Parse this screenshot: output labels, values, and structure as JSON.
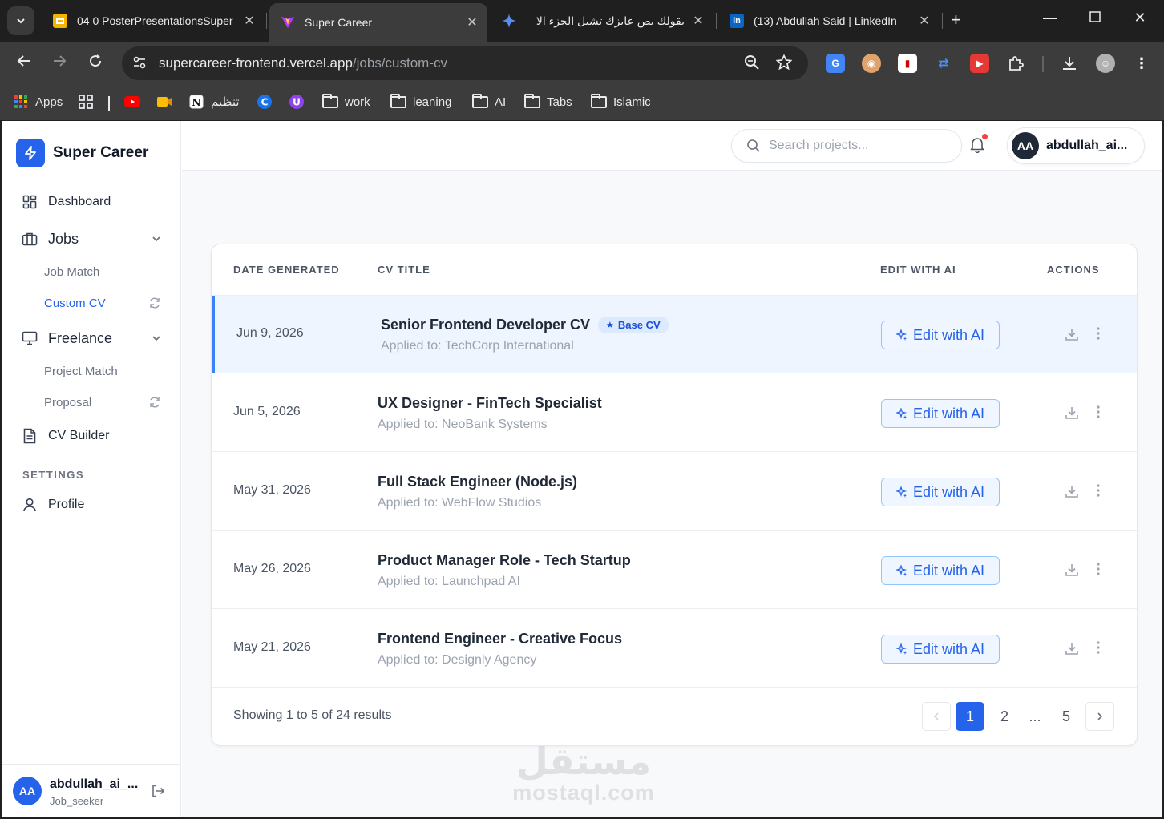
{
  "browser": {
    "tabs": [
      {
        "title": "04 0 PosterPresentationsSuper",
        "icon": "slides-icon"
      },
      {
        "title": "Super Career",
        "icon": "vite-icon"
      },
      {
        "title": "يقولك بص عايزك تشيل الجزء الا",
        "icon": "gemini-icon"
      },
      {
        "title": "(13) Abdullah Said | LinkedIn",
        "icon": "linkedin-icon"
      }
    ],
    "url_host": "supercareer-frontend.vercel.app",
    "url_path": "/jobs/custom-cv",
    "bookmarks": [
      {
        "label": "Apps",
        "icon": "apps-grid-icon"
      },
      {
        "label": "",
        "icon": "grid-icon"
      },
      {
        "label": "",
        "icon": "youtube-icon"
      },
      {
        "label": "",
        "icon": "meet-icon"
      },
      {
        "label": "تنظيم",
        "icon": "notion-icon"
      },
      {
        "label": "",
        "icon": "c-icon"
      },
      {
        "label": "",
        "icon": "u-icon"
      },
      {
        "label": "work",
        "icon": "folder-icon"
      },
      {
        "label": "leaning",
        "icon": "folder-icon"
      },
      {
        "label": "AI",
        "icon": "folder-icon"
      },
      {
        "label": "Tabs",
        "icon": "folder-icon"
      },
      {
        "label": "Islamic",
        "icon": "folder-icon"
      }
    ]
  },
  "sidebar": {
    "brand": "Super Career",
    "nav": {
      "dashboard": "Dashboard",
      "jobs": "Jobs",
      "job_match": "Job Match",
      "custom_cv": "Custom CV",
      "freelance": "Freelance",
      "project_match": "Project Match",
      "proposal": "Proposal",
      "cv_builder": "CV Builder",
      "settings_heading": "SETTINGS",
      "profile": "Profile"
    },
    "user": {
      "initials": "AA",
      "name": "abdullah_ai_...",
      "role": "Job_seeker"
    }
  },
  "topbar": {
    "search_placeholder": "Search projects...",
    "user_initials": "AA",
    "user_name": "abdullah_ai..."
  },
  "table": {
    "headers": {
      "date": "DATE GENERATED",
      "title": "CV TITLE",
      "edit": "EDIT WITH AI",
      "actions": "ACTIONS"
    },
    "edit_label": "Edit with AI",
    "base_badge": "Base CV",
    "rows": [
      {
        "date": "Jun 9, 2026",
        "title": "Senior Frontend Developer CV",
        "applied": "Applied to: TechCorp International",
        "base": true
      },
      {
        "date": "Jun 5, 2026",
        "title": "UX Designer - FinTech Specialist",
        "applied": "Applied to: NeoBank Systems",
        "base": false
      },
      {
        "date": "May 31, 2026",
        "title": "Full Stack Engineer (Node.js)",
        "applied": "Applied to: WebFlow Studios",
        "base": false
      },
      {
        "date": "May 26, 2026",
        "title": "Product Manager Role - Tech Startup",
        "applied": "Applied to: Launchpad AI",
        "base": false
      },
      {
        "date": "May 21, 2026",
        "title": "Frontend Engineer - Creative Focus",
        "applied": "Applied to: Designly Agency",
        "base": false
      }
    ],
    "footer": {
      "showing": "Showing 1 to 5 of 24 results",
      "pages": [
        "1",
        "2",
        "...",
        "5"
      ],
      "current_page": "1"
    }
  },
  "watermark": {
    "arabic": "مستقل",
    "latin": "mostaql.com"
  },
  "colors": {
    "accent": "#2563eb",
    "selected_row": "#eff5ff",
    "sidebar_active": "#2563eb"
  }
}
